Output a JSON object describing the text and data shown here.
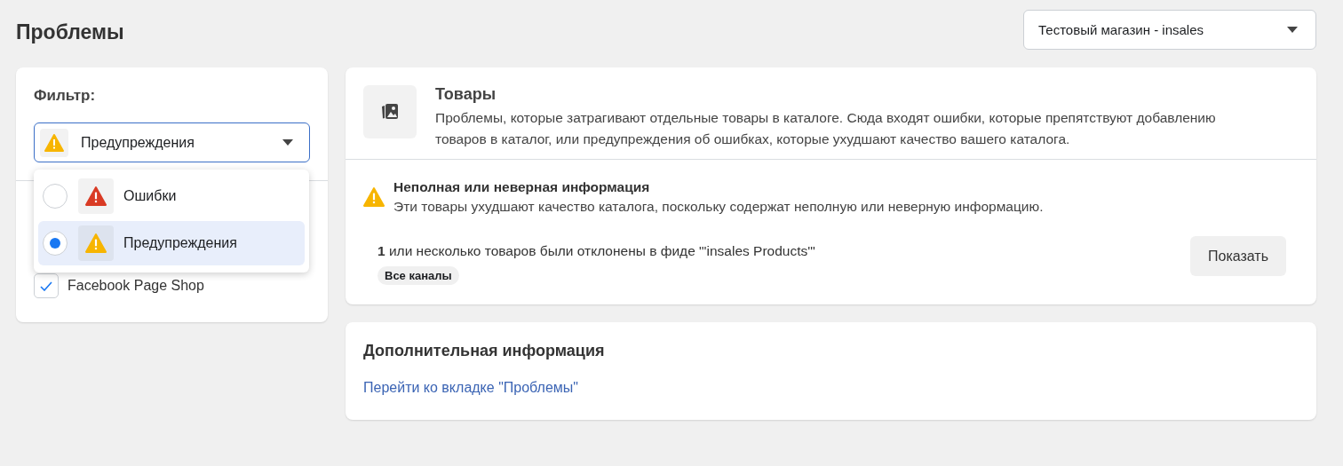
{
  "page_title": "Проблемы",
  "channel_select": {
    "value": "Тестовый магазин - insales"
  },
  "filter": {
    "label": "Фильтр:",
    "value": {
      "kind": "warning",
      "label": "Предупреждения"
    },
    "menu_open": true,
    "options": [
      {
        "kind": "error",
        "label": "Ошибки",
        "selected": false
      },
      {
        "kind": "warning",
        "label": "Предупреждения",
        "selected": true
      }
    ],
    "channels": [
      {
        "label": "Facebook Page Shop",
        "checked": true
      }
    ]
  },
  "products_card": {
    "title": "Товары",
    "description": "Проблемы, которые затрагивают отдельные товары в каталоге. Сюда входят ошибки, которые препятствуют добавлению товаров в каталог, или предупреждения об ошибках, которые ухудшают качество вашего каталога.",
    "issues": [
      {
        "kind": "warning",
        "title": "Неполная или неверная информация",
        "description": "Эти товары ухудшают качество каталога, поскольку содержат неполную или неверную информацию.",
        "items": [
          {
            "text": "**1** или несколько товаров были отклонены в фиде \"'insales Products'\"",
            "tag": "Все каналы",
            "button": "Показать"
          }
        ]
      }
    ]
  },
  "info_card": {
    "title": "Дополнительная информация",
    "link": "Перейти ко вкладке \"Проблемы\""
  }
}
